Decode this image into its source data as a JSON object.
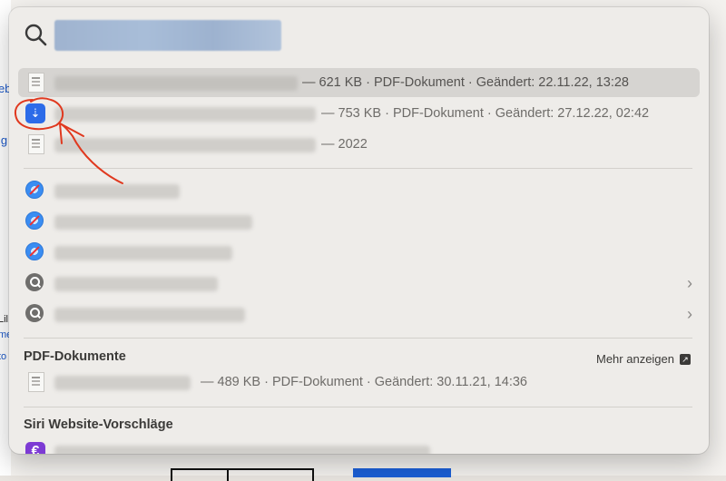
{
  "background": {
    "left_text_fragments": [
      "eb",
      "ig",
      "Lil",
      "me",
      "to"
    ]
  },
  "spotlight": {
    "query": "",
    "results_top": [
      {
        "icon": "pdf-document-icon",
        "meta": "— 621 KB · PDF-Dokument · Geändert: 22.11.22, 13:28",
        "selected": true
      },
      {
        "icon": "dropbox-icon",
        "meta": "— 753 KB · PDF-Dokument · Geändert: 27.12.22, 02:42",
        "selected": false
      },
      {
        "icon": "pdf-document-icon",
        "meta": "— 2022",
        "selected": false
      }
    ],
    "results_web": [
      {
        "icon": "safari-icon"
      },
      {
        "icon": "safari-icon"
      },
      {
        "icon": "safari-icon"
      },
      {
        "icon": "search-suggestion-icon",
        "chevron": "›"
      },
      {
        "icon": "search-suggestion-icon",
        "chevron": "›"
      }
    ],
    "section_pdf": {
      "title": "PDF-Dokumente",
      "more_label": "Mehr anzeigen",
      "items": [
        {
          "icon": "pdf-document-icon",
          "meta": "— 489 KB · PDF-Dokument · Geändert: 30.11.21, 14:36"
        }
      ]
    },
    "section_siri": {
      "title": "Siri Website-Vorschläge",
      "items": [
        {
          "icon": "euro-icon",
          "glyph": "€"
        }
      ]
    }
  },
  "colors": {
    "selection": "#d6d4d1",
    "annotation": "#e0391f",
    "dropbox": "#2c6be8"
  }
}
